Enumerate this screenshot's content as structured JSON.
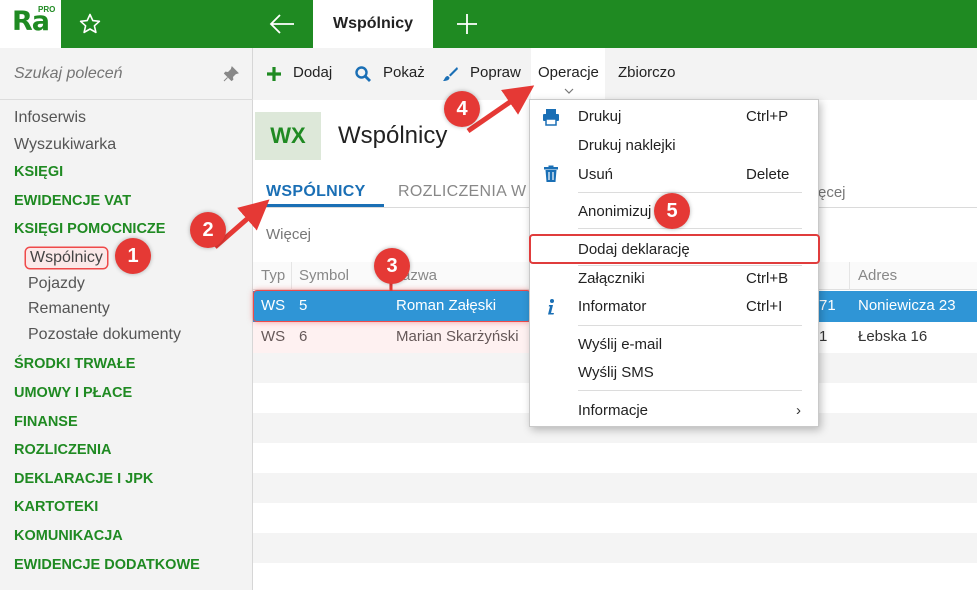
{
  "app": {
    "logo": "Ra",
    "logo_sup": "PRO",
    "active_tab": "Wspólnicy"
  },
  "search": {
    "placeholder": "Szukaj poleceń"
  },
  "sidebar": {
    "items": [
      {
        "label": "Infoserwis",
        "kind": "link"
      },
      {
        "label": "Wyszukiwarka",
        "kind": "link"
      },
      {
        "label": "KSIĘGI",
        "kind": "section"
      },
      {
        "label": "EWIDENCJE VAT",
        "kind": "section"
      },
      {
        "label": "KSIĘGI POMOCNICZE",
        "kind": "section"
      },
      {
        "label": "Wspólnicy",
        "kind": "sub-selected"
      },
      {
        "label": "Pojazdy",
        "kind": "sub"
      },
      {
        "label": "Remanenty",
        "kind": "sub"
      },
      {
        "label": "Pozostałe dokumenty",
        "kind": "sub"
      },
      {
        "label": "ŚRODKI TRWAŁE",
        "kind": "section"
      },
      {
        "label": "UMOWY I PŁACE",
        "kind": "section"
      },
      {
        "label": "FINANSE",
        "kind": "section"
      },
      {
        "label": "ROZLICZENIA",
        "kind": "section"
      },
      {
        "label": "DEKLARACJE I JPK",
        "kind": "section"
      },
      {
        "label": "KARTOTEKI",
        "kind": "section"
      },
      {
        "label": "KOMUNIKACJA",
        "kind": "section"
      },
      {
        "label": "EWIDENCJE DODATKOWE",
        "kind": "section"
      }
    ]
  },
  "toolbar": {
    "add": "Dodaj",
    "show": "Pokaż",
    "edit": "Popraw",
    "operations": "Operacje",
    "summary": "Zbiorczo"
  },
  "header": {
    "badge": "WX",
    "title": "Wspólnicy"
  },
  "tabs": {
    "partners": "WSPÓLNICY",
    "settlements": "ROZLICZENIA W",
    "more": "ęcej"
  },
  "filter": {
    "more": "Więcej"
  },
  "table": {
    "columns": {
      "type": "Typ",
      "symbol": "Symbol",
      "name": "azwa",
      "address": "Adres"
    },
    "rows": [
      {
        "type": "WS",
        "symbol": "5",
        "name": "Roman Załęski",
        "code_tail": "71",
        "address": "Noniewicza 23"
      },
      {
        "type": "WS",
        "symbol": "6",
        "name": "Marian Skarżyński",
        "code_tail": "1",
        "address": "Łebska 16"
      }
    ]
  },
  "menu": {
    "print": {
      "label": "Drukuj",
      "shortcut": "Ctrl+P"
    },
    "print_labels": {
      "label": "Drukuj naklejki"
    },
    "delete": {
      "label": "Usuń",
      "shortcut": "Delete"
    },
    "anonymize": {
      "label": "Anonimizuj"
    },
    "add_declaration": {
      "label": "Dodaj deklarację"
    },
    "attachments": {
      "label": "Załączniki",
      "shortcut": "Ctrl+B"
    },
    "informator": {
      "label": "Informator",
      "shortcut": "Ctrl+I"
    },
    "send_email": {
      "label": "Wyślij e-mail"
    },
    "send_sms": {
      "label": "Wyślij SMS"
    },
    "information": {
      "label": "Informacje",
      "arrow": "›"
    }
  },
  "annotations": [
    "1",
    "2",
    "3",
    "4",
    "5"
  ],
  "colors": {
    "brand": "#1f8a22",
    "accent": "#1a6fb5",
    "selection": "#2f95d6",
    "annotation": "#e53935"
  }
}
